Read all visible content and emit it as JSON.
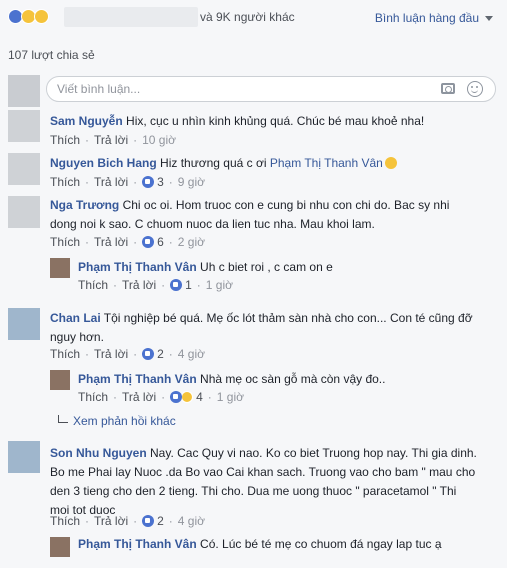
{
  "header": {
    "others_text": "và 9K người khác",
    "sort_label": "Bình luận hàng đầu",
    "shares": "107 lượt chia sẻ"
  },
  "composer": {
    "placeholder": "Viết bình luận..."
  },
  "actions": {
    "like": "Thích",
    "reply": "Trả lời"
  },
  "comments": [
    {
      "author": "Sam Nguyễn",
      "text": "Hix, cục u nhìn kinh khủng quá. Chúc bé mau khoẻ nha!",
      "time": "10 giờ"
    },
    {
      "author": "Nguyen Bich Hang",
      "text": "Hiz thương quá c ơi",
      "mention": "Phạm Thị Thanh Vân",
      "count": "3",
      "time": "9 giờ"
    },
    {
      "author": "Nga Trương",
      "text_line1": "Chi oc oi. Hom truoc con e cung bi nhu con chi do. Bac sy nhi",
      "text_line2": "dong noi k sao. C chuom nuoc da lien tuc nha. Mau khoi lam.",
      "count": "6",
      "time": "2 giờ"
    },
    {
      "author": "Phạm Thị Thanh Vân",
      "text": "Uh c biet roi , c cam on e",
      "count": "1",
      "time": "1 giờ"
    },
    {
      "author": "Chan Lai",
      "text_line1": "Tội nghiệp bé quá. Mẹ ốc lót thảm sàn nhà cho con... Con té cũng đỡ",
      "text_line2": "nguy hơn.",
      "count": "2",
      "time": "4 giờ"
    },
    {
      "author": "Phạm Thị Thanh Vân",
      "text": "Nhà mẹ oc sàn gỗ mà còn vậy đo..",
      "count": "4",
      "time": "1 giờ"
    },
    {
      "author": "Son Nhu Nguyen",
      "text_line1": "Nay. Cac Quy vi nao. Ko co biet Truong hop nay. Thi gia dinh.",
      "text_line2": "Bo me Phai lay Nuoc .da Bo vao Cai khan sach. Truong vao cho bam \" mau cho",
      "text_line3": "den 3 tieng cho den 2 tieng. Thi cho. Dua me uong thuoc \" paracetamol \" Thi",
      "text_line4": "moi tot duoc",
      "count": "2",
      "time": "4 giờ"
    },
    {
      "author": "Phạm Thị Thanh Vân",
      "text": "Có. Lúc bé té mẹ co chuom đá ngay lap tuc ạ"
    }
  ],
  "more_replies": "Xem phản hồi khác"
}
